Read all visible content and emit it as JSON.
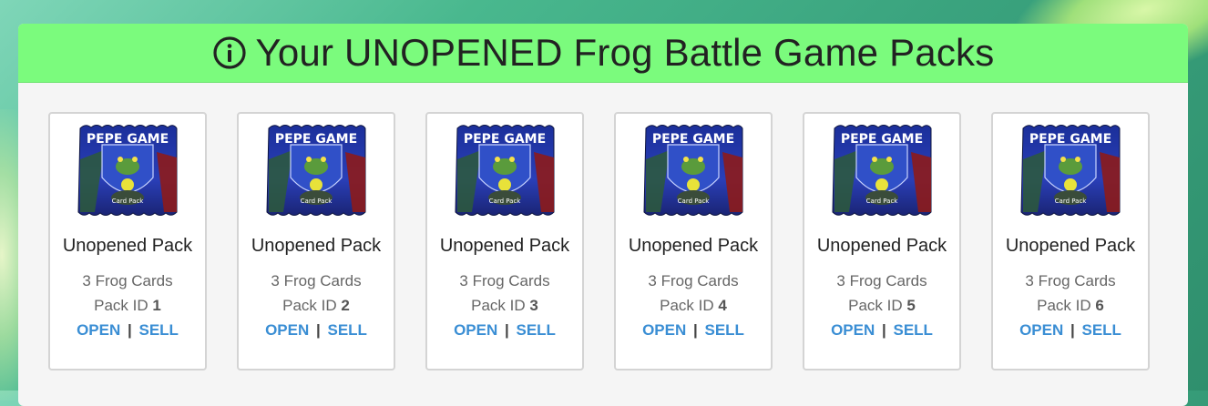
{
  "header": {
    "title": "Your UNOPENED Frog Battle Game Packs",
    "icon": "info-circle-icon"
  },
  "colors": {
    "header_bg": "#7bfb7d",
    "link": "#3a8ed4",
    "panel_bg": "#f5f5f5"
  },
  "packs": [
    {
      "art_title": "PEPE GAME",
      "art_subtitle": "Card Pack",
      "name": "Unopened Pack",
      "count": "3 Frog Cards",
      "id_label": "Pack ID",
      "id": "1",
      "open": "OPEN",
      "sep": "|",
      "sell": "SELL"
    },
    {
      "art_title": "PEPE GAME",
      "art_subtitle": "Card Pack",
      "name": "Unopened Pack",
      "count": "3 Frog Cards",
      "id_label": "Pack ID",
      "id": "2",
      "open": "OPEN",
      "sep": "|",
      "sell": "SELL"
    },
    {
      "art_title": "PEPE GAME",
      "art_subtitle": "Card Pack",
      "name": "Unopened Pack",
      "count": "3 Frog Cards",
      "id_label": "Pack ID",
      "id": "3",
      "open": "OPEN",
      "sep": "|",
      "sell": "SELL"
    },
    {
      "art_title": "PEPE GAME",
      "art_subtitle": "Card Pack",
      "name": "Unopened Pack",
      "count": "3 Frog Cards",
      "id_label": "Pack ID",
      "id": "4",
      "open": "OPEN",
      "sep": "|",
      "sell": "SELL"
    },
    {
      "art_title": "PEPE GAME",
      "art_subtitle": "Card Pack",
      "name": "Unopened Pack",
      "count": "3 Frog Cards",
      "id_label": "Pack ID",
      "id": "5",
      "open": "OPEN",
      "sep": "|",
      "sell": "SELL"
    },
    {
      "art_title": "PEPE GAME",
      "art_subtitle": "Card Pack",
      "name": "Unopened Pack",
      "count": "3 Frog Cards",
      "id_label": "Pack ID",
      "id": "6",
      "open": "OPEN",
      "sep": "|",
      "sell": "SELL"
    }
  ]
}
